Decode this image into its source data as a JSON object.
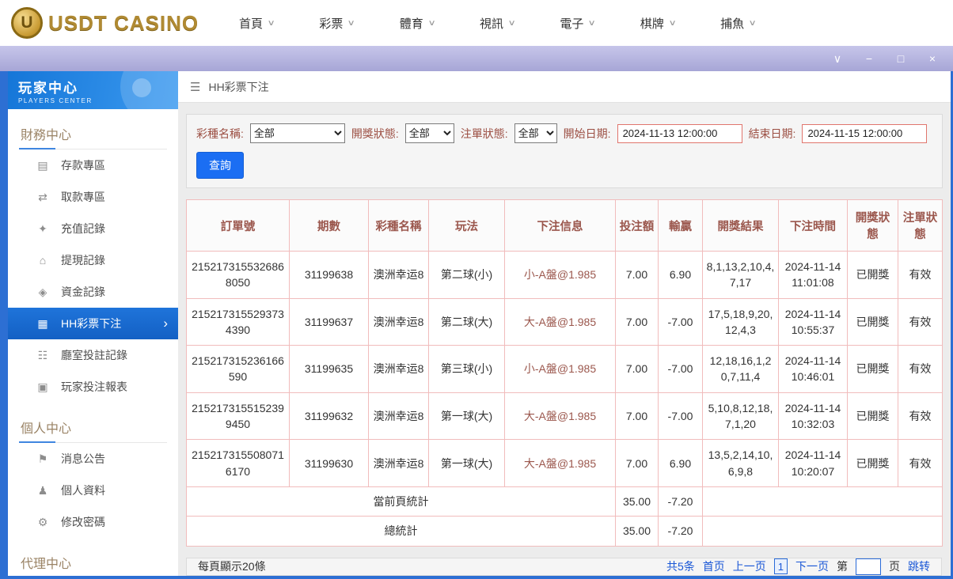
{
  "header": {
    "logo_coin_letter": "U",
    "logo_text": "USDT CASINO",
    "nav": [
      {
        "label": "首頁"
      },
      {
        "label": "彩票"
      },
      {
        "label": "體育"
      },
      {
        "label": "視訊"
      },
      {
        "label": "電子"
      },
      {
        "label": "棋牌"
      },
      {
        "label": "捕魚"
      }
    ]
  },
  "sidebar": {
    "title": "玩家中心",
    "subtitle": "PLAYERS CENTER",
    "sections": [
      {
        "label": "財務中心",
        "items": [
          {
            "label": "存款專區",
            "icon": "deposit-icon"
          },
          {
            "label": "取款專區",
            "icon": "withdraw-icon"
          },
          {
            "label": "充值記錄",
            "icon": "recharge-record-icon"
          },
          {
            "label": "提現記錄",
            "icon": "cashout-record-icon"
          },
          {
            "label": "資金記錄",
            "icon": "funds-record-icon"
          },
          {
            "label": "HH彩票下注",
            "icon": "lottery-bet-icon",
            "active": true
          },
          {
            "label": "廳室投註記錄",
            "icon": "room-bet-record-icon"
          },
          {
            "label": "玩家投注報表",
            "icon": "player-report-icon"
          }
        ]
      },
      {
        "label": "個人中心",
        "items": [
          {
            "label": "消息公告",
            "icon": "announcement-icon"
          },
          {
            "label": "個人資料",
            "icon": "profile-icon"
          },
          {
            "label": "修改密碼",
            "icon": "change-password-icon"
          }
        ]
      },
      {
        "label": "代理中心",
        "items": []
      }
    ]
  },
  "breadcrumb": {
    "title": "HH彩票下注"
  },
  "filters": {
    "lottery_label": "彩種名稱:",
    "lottery_value": "全部",
    "draw_status_label": "開獎狀態:",
    "draw_status_value": "全部",
    "order_status_label": "注單狀態:",
    "order_status_value": "全部",
    "start_label": "開始日期:",
    "start_value": "2024-11-13 12:00:00",
    "end_label": "結束日期:",
    "end_value": "2024-11-15 12:00:00",
    "search_button": "查詢"
  },
  "table": {
    "headers": [
      "訂單號",
      "期數",
      "彩種名稱",
      "玩法",
      "下注信息",
      "投注額",
      "輸贏",
      "開獎結果",
      "下注時間",
      "開獎狀態",
      "注單狀態"
    ],
    "rows": [
      [
        "2152173155326868050",
        "31199638",
        "澳洲幸运8",
        "第二球(小)",
        "小-A盤@1.985",
        "7.00",
        "6.90",
        "8,1,13,2,10,4,7,17",
        "2024-11-14 11:01:08",
        "已開獎",
        "有效"
      ],
      [
        "2152173155293734390",
        "31199637",
        "澳洲幸运8",
        "第二球(大)",
        "大-A盤@1.985",
        "7.00",
        "-7.00",
        "17,5,18,9,20,12,4,3",
        "2024-11-14 10:55:37",
        "已開獎",
        "有效"
      ],
      [
        "215217315236166590",
        "31199635",
        "澳洲幸运8",
        "第三球(小)",
        "小-A盤@1.985",
        "7.00",
        "-7.00",
        "12,18,16,1,20,7,11,4",
        "2024-11-14 10:46:01",
        "已開獎",
        "有效"
      ],
      [
        "2152173155152399450",
        "31199632",
        "澳洲幸运8",
        "第一球(大)",
        "大-A盤@1.985",
        "7.00",
        "-7.00",
        "5,10,8,12,18,7,1,20",
        "2024-11-14 10:32:03",
        "已開獎",
        "有效"
      ],
      [
        "2152173155080716170",
        "31199630",
        "澳洲幸运8",
        "第一球(大)",
        "大-A盤@1.985",
        "7.00",
        "6.90",
        "13,5,2,14,10,6,9,8",
        "2024-11-14 10:20:07",
        "已開獎",
        "有效"
      ]
    ],
    "summary": [
      {
        "label": "當前頁統計",
        "bet": "35.00",
        "win_loss": "-7.20"
      },
      {
        "label": "總統計",
        "bet": "35.00",
        "win_loss": "-7.20"
      }
    ]
  },
  "pagination": {
    "per_page": "每頁顯示20條",
    "total": "共5条",
    "first": "首页",
    "prev": "上一页",
    "current": "1",
    "next": "下一页",
    "jump_prefix": "第",
    "jump_suffix": "页",
    "jump_action": "跳转"
  },
  "icons": {
    "menu-icon": "☰",
    "chevron-down-icon": "∨",
    "chevron-right-icon": "›",
    "collapse-icon": "∨",
    "minimize-icon": "−",
    "maximize-icon": "□",
    "close-icon": "×",
    "deposit-icon": "▤",
    "withdraw-icon": "⇄",
    "recharge-record-icon": "✦",
    "cashout-record-icon": "⌂",
    "funds-record-icon": "◈",
    "lottery-bet-icon": "▦",
    "room-bet-record-icon": "☷",
    "player-report-icon": "▣",
    "announcement-icon": "⚑",
    "profile-icon": "♟",
    "change-password-icon": "⚙"
  },
  "colors": {
    "brand_gold": "#b08a33",
    "sidebar_header_blue": "#1576d8",
    "active_item_blue": "#1467d2",
    "button_blue": "#1b6ef3",
    "link_blue": "#1a57d6",
    "table_border_pink": "#f1bcbc",
    "table_header_text": "#9b574d",
    "filter_label_maroon": "#9c4f43",
    "date_input_border": "#e0756d",
    "titlebar_purple": "#a7a6d6",
    "frame_border_blue": "#2d6fd3"
  }
}
